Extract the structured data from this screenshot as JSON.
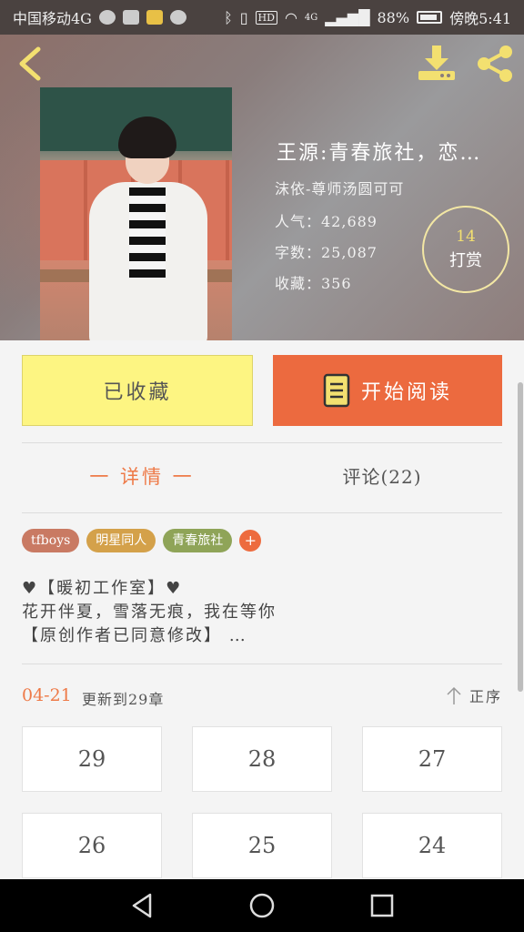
{
  "status_bar": {
    "carrier": "中国移动4G",
    "network": "4G",
    "battery": "88%",
    "time": "傍晚5:41"
  },
  "header": {
    "icons": [
      "back-arrow-icon",
      "download-icon",
      "share-icon"
    ],
    "book": {
      "title": "王源:青春旅社，恋…",
      "author": "沫依-尊师汤圆可可",
      "popularity": "人气：42,689",
      "word_count": "字数：25,087",
      "favorites": "收藏：356"
    },
    "tip": {
      "count": "14",
      "label": "打赏"
    }
  },
  "actions": {
    "favorite_label": "已收藏",
    "read_label": "开始阅读"
  },
  "tabs": {
    "detail": "一 详情 一",
    "comments": "评论(22)"
  },
  "tags": [
    "tfboys",
    "明星同人",
    "青春旅社",
    "+"
  ],
  "description": {
    "line1": "♥【暖初工作室】♥",
    "line2": "花开伴夏，雪落无痕，我在等你",
    "line3": "【原创作者已同意修改】 …"
  },
  "update": {
    "date": "04-21",
    "text": "更新到29章",
    "sort_label": "正序"
  },
  "chapters": [
    "29",
    "28",
    "27",
    "26",
    "25",
    "24"
  ],
  "colors": {
    "accent_orange": "#ec6a3f",
    "favorite_yellow": "#fdf582",
    "tip_yellow": "#f3e070"
  }
}
